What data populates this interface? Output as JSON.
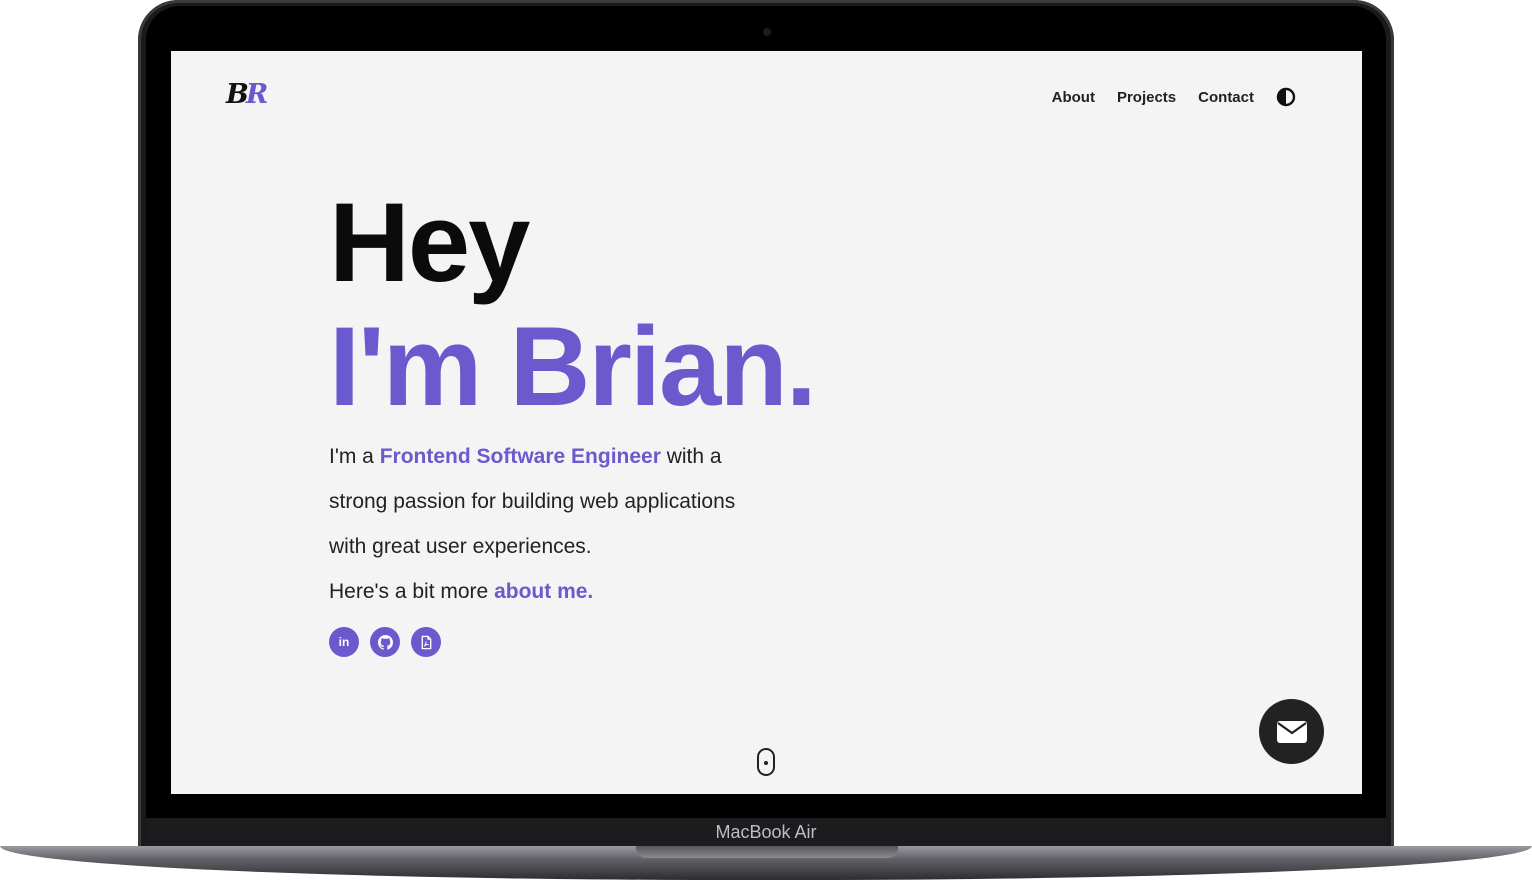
{
  "device": {
    "model_label": "MacBook Air"
  },
  "site": {
    "logo": {
      "first": "B",
      "second": "R"
    },
    "nav": {
      "about": "About",
      "projects": "Projects",
      "contact": "Contact"
    },
    "theme_toggle_icon": "half-circle-contrast-icon"
  },
  "hero": {
    "greeting": "Hey",
    "name_line": "I'm Brian.",
    "intro_pre": "I'm a ",
    "intro_role": "Frontend Software Engineer",
    "intro_post": " with a strong passion for building web applications with great user experiences.",
    "more_pre": "Here's a bit more ",
    "more_link": "about me."
  },
  "socials": [
    {
      "name": "LinkedIn",
      "icon": "linkedin-icon",
      "glyph": "in"
    },
    {
      "name": "GitHub",
      "icon": "github-icon"
    },
    {
      "name": "Resume",
      "icon": "pdf-file-icon"
    }
  ],
  "colors": {
    "accent": "#6a5acd",
    "page_bg": "#f4f4f4",
    "dark": "#222222"
  },
  "fab_icon": "envelope-icon",
  "scroll_icon": "mouse-scroll-icon"
}
